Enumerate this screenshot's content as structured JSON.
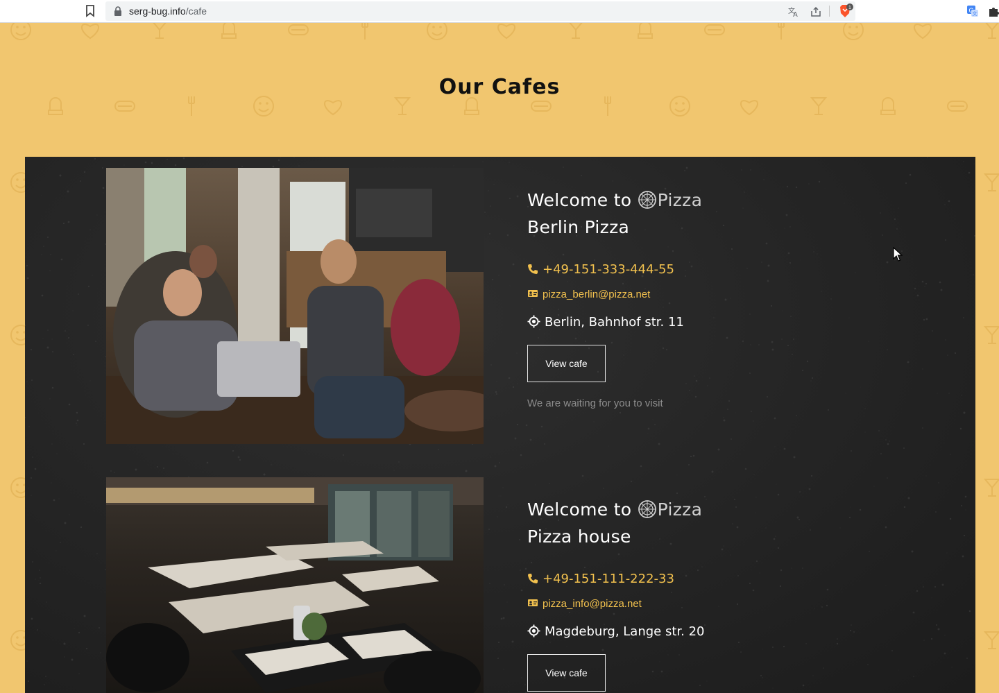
{
  "browser": {
    "url_host": "serg-bug.info",
    "url_path": "/cafe",
    "brave_badge_count": "1"
  },
  "page": {
    "title": "Our Cafes"
  },
  "cafes": [
    {
      "welcome_prefix": "Welcome to",
      "logo_word": "Pizza",
      "name": "Berlin Pizza",
      "phone": "+49-151-333-444-55",
      "email": "pizza_berlin@pizza.net",
      "address": "Berlin, Bahnhof str. 11",
      "button_label": "View cafe",
      "note": "We are waiting for you to visit"
    },
    {
      "welcome_prefix": "Welcome to",
      "logo_word": "Pizza",
      "name": "Pizza house",
      "phone": "+49-151-111-222-33",
      "email": "pizza_info@pizza.net",
      "address": "Magdeburg, Lange str. 20",
      "button_label": "View cafe"
    }
  ],
  "colors": {
    "page_bg": "#f1c66f",
    "board_bg": "#262626",
    "accent": "#f2c14e"
  }
}
